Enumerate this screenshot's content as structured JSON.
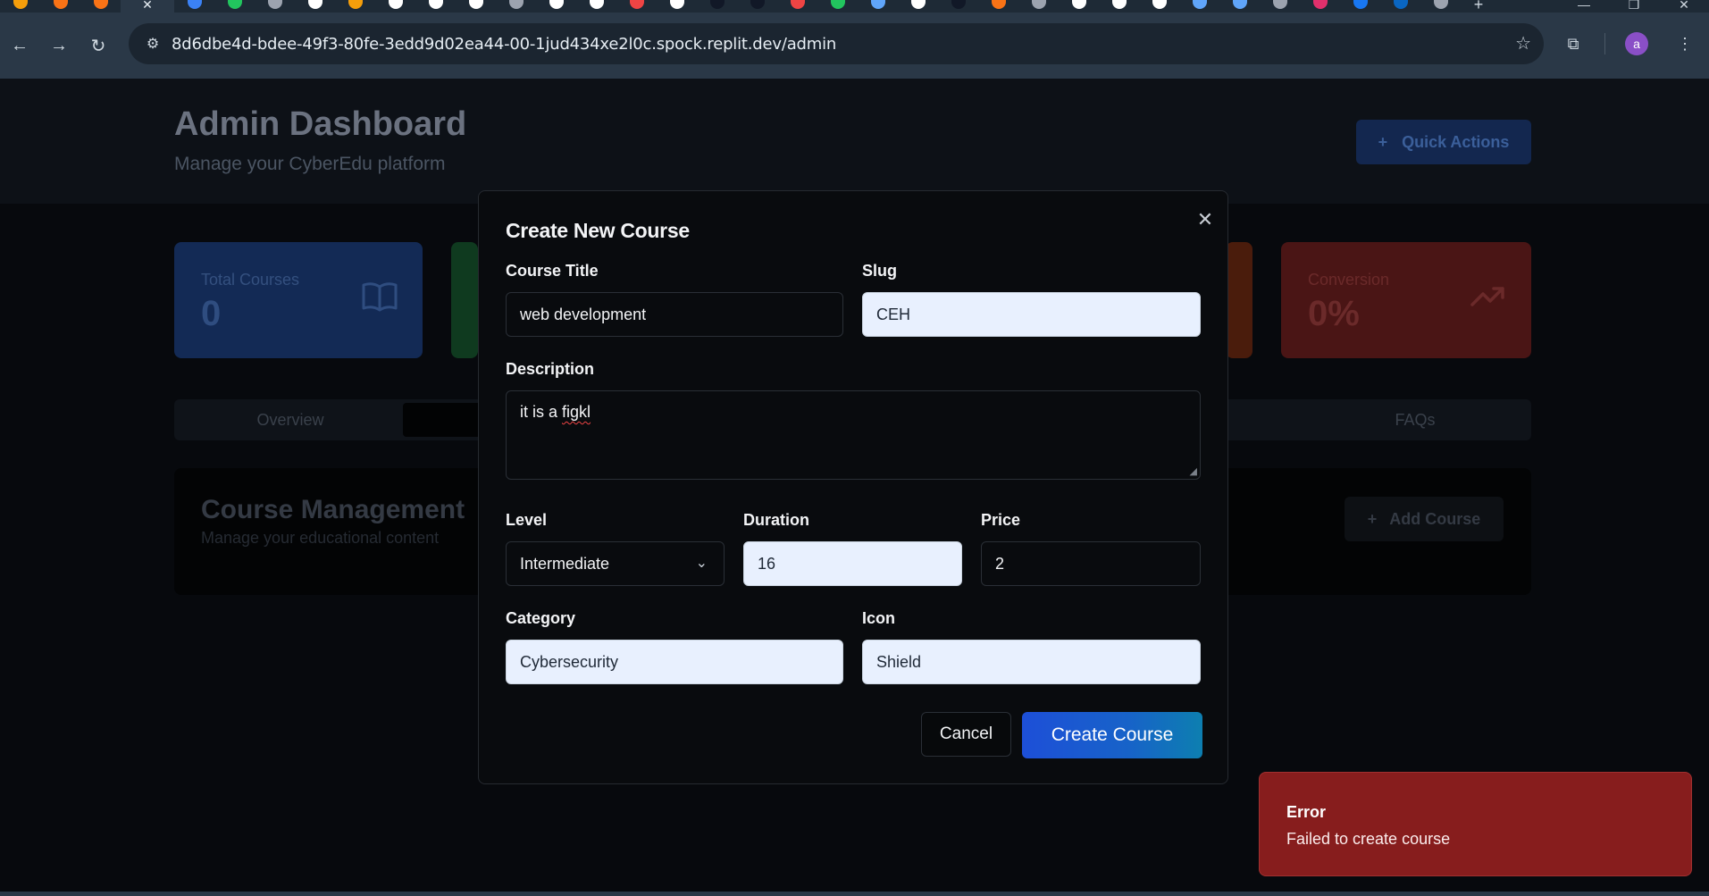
{
  "browser": {
    "url": "8d6dbe4d-bdee-49f3-80fe-3edd9d02ea44-00-1jud434xe2l0c.spock.replit.dev/admin",
    "active_tab_close": "✕",
    "new_tab": "+",
    "profile_initial": "a",
    "tab_favicons": [
      "#f59e0b",
      "#f97316",
      "#f97316",
      "#3b82f6",
      "#22c55e",
      "#9ca3af",
      "#ffffff",
      "#f59e0b",
      "#ffffff",
      "#ffffff",
      "#ffffff",
      "#9ca3af",
      "#ffffff",
      "#ffffff",
      "#ef4444",
      "#ffffff",
      "#111827",
      "#111827",
      "#ef4444",
      "#22c55e",
      "#60a5fa",
      "#ffffff",
      "#111827",
      "#f97316",
      "#9ca3af",
      "#ffffff",
      "#ffffff",
      "#ffffff",
      "#60a5fa",
      "#60a5fa",
      "#9ca3af",
      "#e1306c",
      "#1877f2",
      "#0a66c2",
      "#9ca3af"
    ]
  },
  "header": {
    "title": "Admin Dashboard",
    "subtitle": "Manage your CyberEdu platform",
    "quick_actions": "Quick Actions"
  },
  "stats": [
    {
      "label": "Total Courses",
      "value": "0",
      "icon": "book-open-icon"
    },
    {
      "label": "Conversion",
      "value": "0%",
      "icon": "trending-up-icon"
    }
  ],
  "tabs": {
    "overview": "Overview",
    "faqs": "FAQs"
  },
  "course_management": {
    "title": "Course Management",
    "subtitle": "Manage your educational content",
    "add_button": "Add Course"
  },
  "modal": {
    "title": "Create New Course",
    "course_title_label": "Course Title",
    "course_title_value": "web development",
    "slug_label": "Slug",
    "slug_value": "CEH",
    "description_label": "Description",
    "description_prefix": "it is a ",
    "description_misspelled": "figkl",
    "level_label": "Level",
    "level_value": "Intermediate",
    "duration_label": "Duration",
    "duration_value": "16",
    "price_label": "Price",
    "price_value": "2",
    "category_label": "Category",
    "category_value": "Cybersecurity",
    "icon_label": "Icon",
    "icon_value": "Shield",
    "cancel": "Cancel",
    "create": "Create Course"
  },
  "toast": {
    "title": "Error",
    "message": "Failed to create course"
  }
}
